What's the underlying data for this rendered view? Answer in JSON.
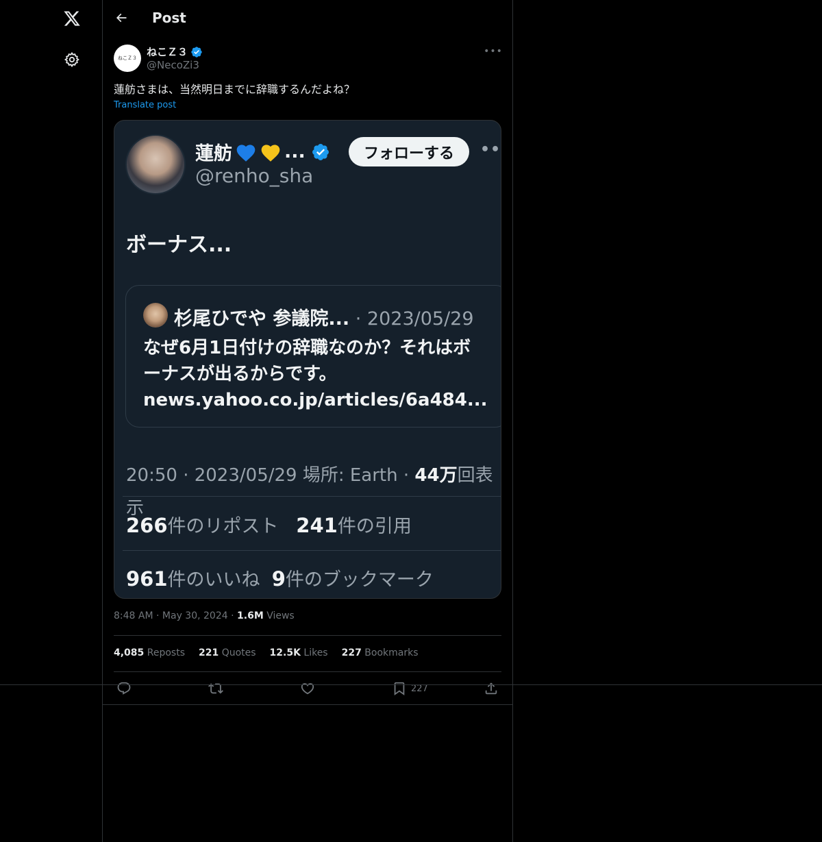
{
  "header": {
    "title": "Post"
  },
  "author": {
    "name": "ねこＺ３",
    "handle": "@NecoZi3",
    "avatar_text": "ねこＺ３"
  },
  "post": {
    "text": "蓮舫さまは、当然明日までに辞職するんだよね？",
    "translate_label": "Translate post"
  },
  "embedded": {
    "name": "蓮舫",
    "ellipsis": "...",
    "handle": "@renho_sha",
    "follow_label": "フォローする",
    "body": "ボーナス...",
    "quote": {
      "name": "杉尾ひでや 参議院...",
      "date": " · 2023/05/29",
      "text_line1": "なぜ6月1日付けの辞職なのか？それはボ",
      "text_line2": "ーナスが出るからです。",
      "text_line3": "news.yahoo.co.jp/articles/6a484..."
    },
    "meta_prefix": "20:50 · 2023/05/29 場所: Earth · ",
    "meta_views_num": "44万",
    "meta_views_suffix": "回表示",
    "reposts_num": "266",
    "reposts_label": "件のリポスト",
    "quotes_num": "241",
    "quotes_label": "件の引用",
    "likes_num": "961",
    "likes_label": "件のいいね",
    "bookmarks_num": "9",
    "bookmarks_label": "件のブックマーク",
    "heart_colors": [
      "#1d7ee8",
      "#f5c31b"
    ]
  },
  "timestamp": {
    "time": "8:48 AM",
    "date": "May 30, 2024",
    "views_num": "1.6M",
    "views_label": "Views"
  },
  "counts": {
    "reposts_num": "4,085",
    "reposts_label": "Reposts",
    "quotes_num": "221",
    "quotes_label": "Quotes",
    "likes_num": "12.5K",
    "likes_label": "Likes",
    "bookmarks_num": "227",
    "bookmarks_label": "Bookmarks"
  },
  "actions": {
    "bookmark_count": "227"
  },
  "colors": {
    "accent": "#1d9bf0",
    "verified": "#1d9bf0",
    "background": "#000000",
    "border": "#2f3336",
    "muted": "#71767b"
  },
  "icons": [
    "x-logo-icon",
    "gear-icon",
    "back-arrow-icon",
    "verified-badge-icon",
    "more-icon",
    "reply-icon",
    "repost-icon",
    "like-icon",
    "bookmark-icon",
    "share-icon"
  ]
}
